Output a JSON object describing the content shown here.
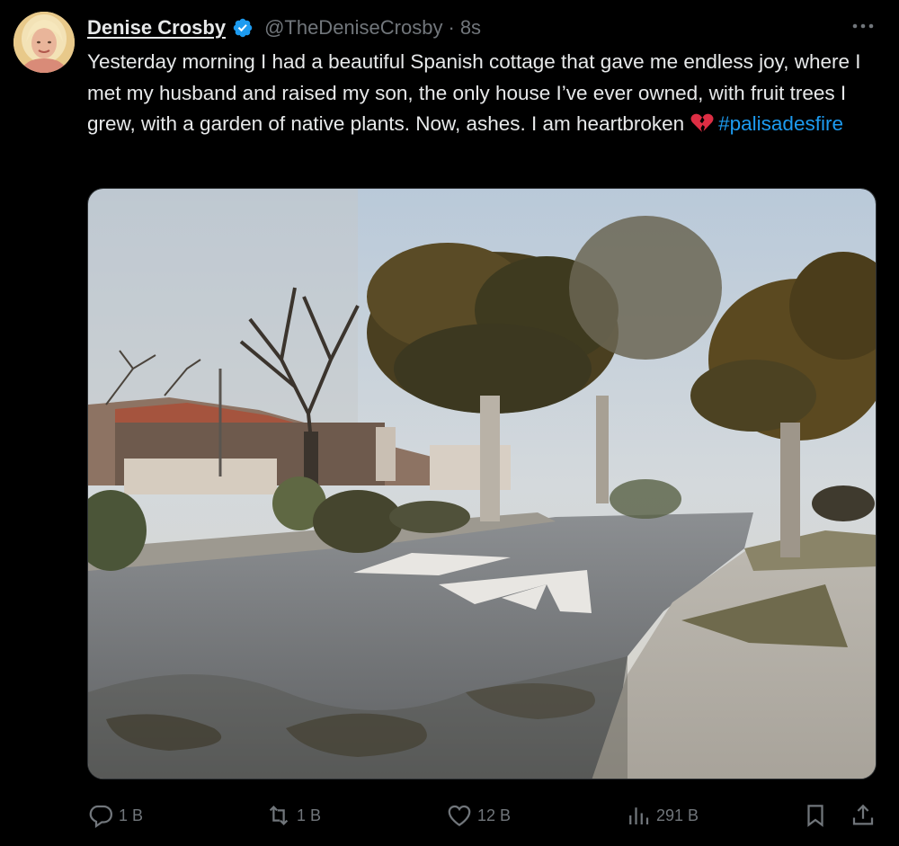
{
  "author": {
    "display_name": "Denise Crosby",
    "handle": "@TheDeniseCrosby",
    "separator": "·",
    "timestamp": "8s",
    "verified": true,
    "verified_color": "#1d9bf0"
  },
  "tweet": {
    "text": "Yesterday morning I had a beautiful Spanish cottage that gave me endless joy, where I met my husband and raised my son, the only house I’ve ever owned, with fruit trees I grew, with a garden of native plants. Now, ashes. I am heartbroken",
    "emoji": "broken-heart-icon",
    "hashtag": "#palisadesfire",
    "hashtag_color": "#1d9bf0"
  },
  "actions": {
    "reply_count": "1 B",
    "retweet_count": "1 B",
    "like_count": "12 B",
    "views_count": "291 B"
  },
  "icons": {
    "more": "more-icon",
    "reply": "reply-icon",
    "retweet": "retweet-icon",
    "like": "heart-icon",
    "views": "views-icon",
    "bookmark": "bookmark-icon",
    "share": "share-icon"
  },
  "colors": {
    "background": "#000000",
    "text": "#e7e9ea",
    "muted": "#71767b",
    "accent": "#1d9bf0"
  }
}
